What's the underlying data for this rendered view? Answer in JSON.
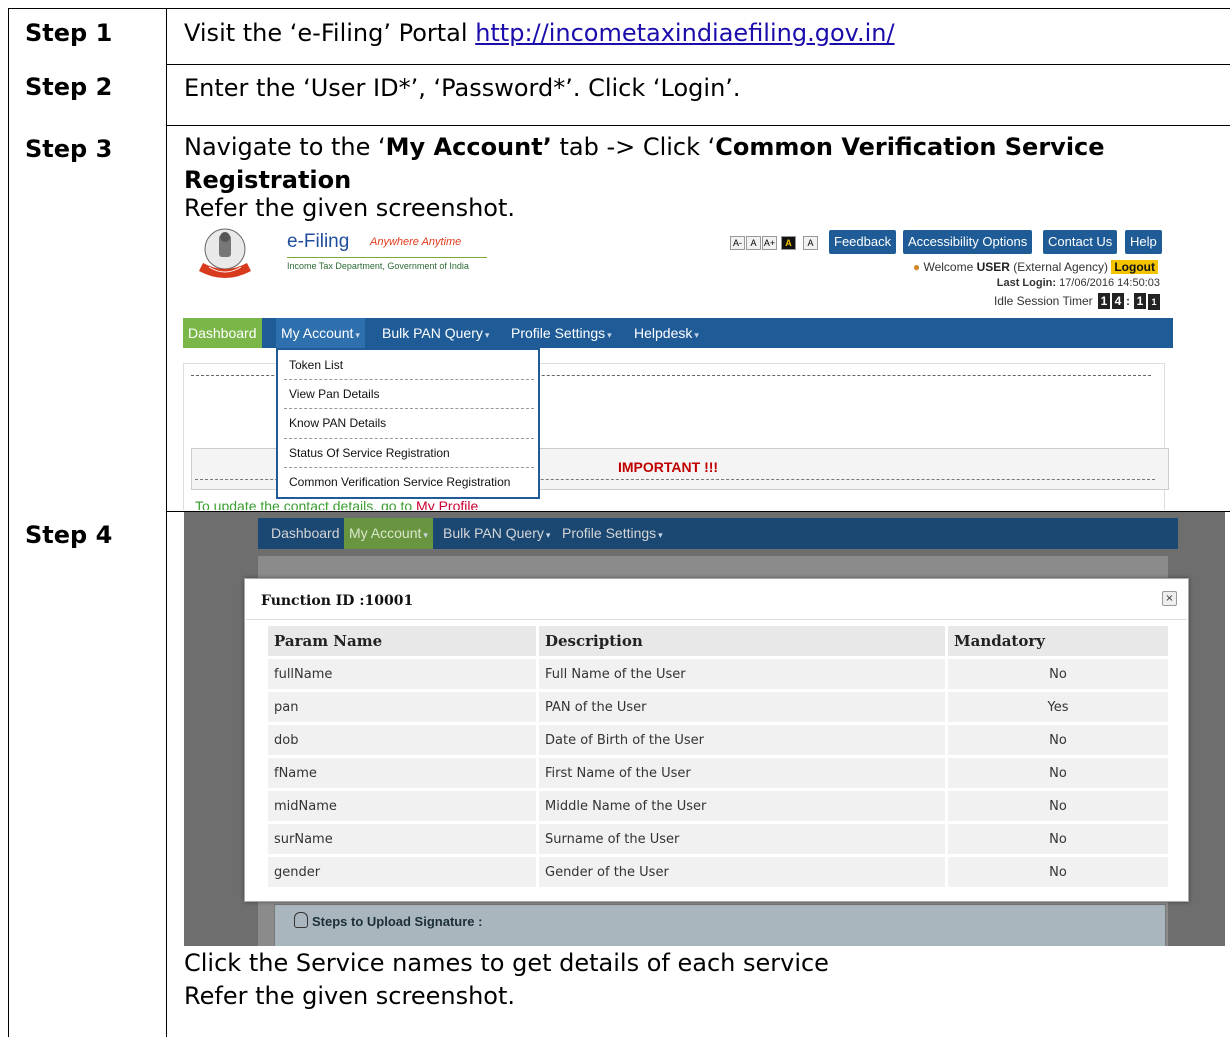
{
  "steps": [
    {
      "label": "Step 1",
      "text": "Visit the ‘e-Filing’ Portal ",
      "link": "http://incometaxindiaefiling.gov.in/"
    },
    {
      "label": "Step 2",
      "text": "Enter the ‘User ID*’, ‘Password*’. Click ‘Login’."
    },
    {
      "label": "Step 3",
      "text_pre": "Navigate to the ‘",
      "bold1": "My Account’",
      "text_mid": " tab -> Click ‘",
      "bold2": "Common Verification Service",
      "bold3": "Registration",
      "refer": "Refer the given screenshot."
    },
    {
      "label": "Step 4",
      "line1": "Click the Service names to get details of each service",
      "line2": "Refer the given screenshot."
    }
  ],
  "shot1": {
    "brand": "e-Filing",
    "tagline": "Anywhere Anytime",
    "department": "Income Tax Department, Government of India",
    "font_sizes": [
      "A-",
      "A",
      "A+",
      "A",
      "A"
    ],
    "top_buttons": [
      "Feedback",
      "Accessibility Options",
      "Contact Us",
      "Help"
    ],
    "welcome_prefix": "Welcome ",
    "user": "USER",
    "agency": " (External Agency) ",
    "logout": "Logout",
    "last_login_label": "Last Login:",
    "last_login": " 17/06/2016 14:50:03",
    "idle_label": "Idle Session Timer ",
    "timer_digits": [
      "1",
      "4",
      "1",
      "1"
    ],
    "nav": [
      "Dashboard",
      "My Account",
      "Bulk PAN Query",
      "Profile Settings",
      "Helpdesk"
    ],
    "dropdown": [
      "Token List",
      "View Pan Details",
      "Know PAN Details",
      "Status Of Service Registration",
      "Common Verification Service Registration"
    ],
    "important": "IMPORTANT !!!",
    "update_text": "To update the contact details, go to ",
    "update_link": "My Profile"
  },
  "shot2": {
    "nav": [
      "Dashboard",
      "My Account",
      "Bulk PAN Query",
      "Profile Settings"
    ],
    "modal_title": "Function ID :10001",
    "close": "×",
    "columns": [
      "Param Name",
      "Description",
      "Mandatory"
    ],
    "rows": [
      [
        "fullName",
        "Full Name of the User",
        "No"
      ],
      [
        "pan",
        "PAN of the User",
        "Yes"
      ],
      [
        "dob",
        "Date of Birth of the User",
        "No"
      ],
      [
        "fName",
        "First Name of the User",
        "No"
      ],
      [
        "midName",
        "Middle Name of the User",
        "No"
      ],
      [
        "surName",
        "Surname of the User",
        "No"
      ],
      [
        "gender",
        "Gender of the User",
        "No"
      ]
    ],
    "signature_title": "Steps to Upload Signature :"
  },
  "colors": {
    "nav_blue": "#1f5c97",
    "active_green": "#7ab648",
    "logout_yellow": "#f5c400",
    "important_red": "#c00000"
  }
}
